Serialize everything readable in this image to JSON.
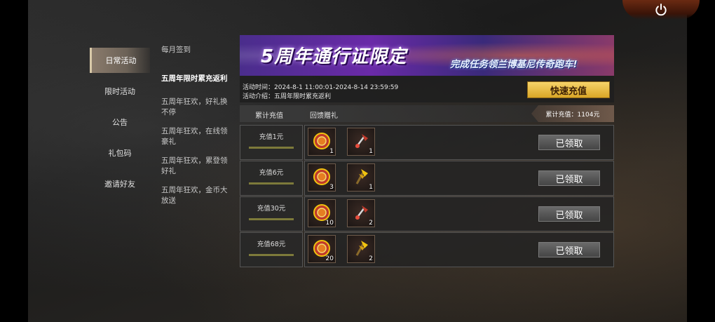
{
  "nav": {
    "items": [
      "日常活动",
      "限时活动",
      "公告",
      "礼包码",
      "邀请好友"
    ],
    "active": 0
  },
  "subnav": {
    "items": [
      "每月签到",
      "五周年限时累充返利",
      "五周年狂欢，好礼换不停",
      "五周年狂欢，在线领豪礼",
      "五周年狂欢，累登领好礼",
      "五周年狂欢，金币大放送"
    ],
    "active": 1
  },
  "banner": {
    "title": "5周年通行证限定",
    "subtitle": "完成任务领兰博基尼传奇跑车!"
  },
  "info": {
    "time": "活动时间：2024-8-1 11:00:01-2024-8-14 23:59:59",
    "intro": "活动介绍：五周年限时累充返利",
    "quick_button": "快速充值"
  },
  "table": {
    "col_recharge": "累计充值",
    "col_reward": "回馈赠礼",
    "total": "累计充值：1104元"
  },
  "rows": [
    {
      "label": "充值1元",
      "items": [
        {
          "icon": "medal-icon",
          "count": "1"
        },
        {
          "icon": "axe-icon",
          "count": "1"
        }
      ],
      "button": "已领取"
    },
    {
      "label": "充值6元",
      "items": [
        {
          "icon": "medal-icon",
          "count": "3"
        },
        {
          "icon": "golden-axe-icon",
          "count": "1"
        }
      ],
      "button": "已领取"
    },
    {
      "label": "充值30元",
      "items": [
        {
          "icon": "medal-icon",
          "count": "10"
        },
        {
          "icon": "axe-icon",
          "count": "2"
        }
      ],
      "button": "已领取"
    },
    {
      "label": "充值68元",
      "items": [
        {
          "icon": "medal-icon",
          "count": "20"
        },
        {
          "icon": "golden-axe-icon",
          "count": "2"
        }
      ],
      "button": "已领取"
    }
  ],
  "colors": {
    "accent": "#d9a626",
    "banner": "#6a2aa8"
  }
}
